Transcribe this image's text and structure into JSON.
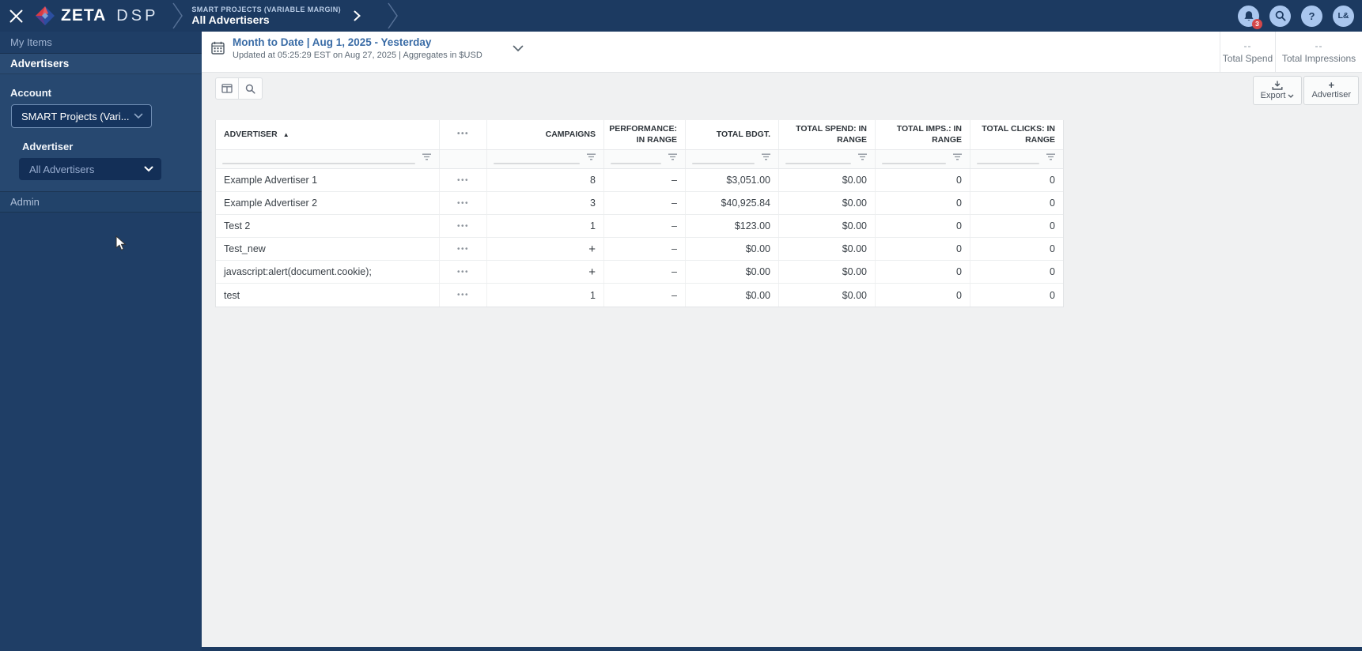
{
  "topbar": {
    "brand_primary": "ZETA",
    "brand_secondary": "DSP",
    "breadcrumb_account": "SMART PROJECTS (VARIABLE MARGIN)",
    "breadcrumb_page": "All Advertisers",
    "notification_count": "3",
    "avatar_initials": "L&"
  },
  "icons": {
    "more_options": "•••",
    "sort_asc": "▲",
    "help": "?",
    "plus": "+"
  },
  "sidebar": {
    "my_items": "My Items",
    "advertisers": "Advertisers",
    "admin": "Admin",
    "account_label": "Account",
    "account_value": "SMART Projects (Vari...",
    "advertiser_label": "Advertiser",
    "advertiser_value": "All Advertisers"
  },
  "date_header": {
    "range": "Month to Date | Aug 1, 2025 - Yesterday",
    "updated": "Updated at 05:25:29 EST on Aug 27, 2025 | Aggregates in $USD"
  },
  "stats": [
    {
      "value": "--",
      "label": "Total Spend"
    },
    {
      "value": "--",
      "label": "Total Impressions"
    }
  ],
  "toolbar": {
    "export": "Export",
    "add_advertiser": "Advertiser"
  },
  "table": {
    "columns": [
      "ADVERTISER",
      "CAMPAIGNS",
      "PERFORMANCE: IN RANGE",
      "TOTAL BDGT.",
      "TOTAL SPEND: IN RANGE",
      "TOTAL IMPS.: IN RANGE",
      "TOTAL CLICKS: IN RANGE"
    ],
    "rows": [
      {
        "advertiser": "Example Advertiser 1",
        "campaigns": "8",
        "performance": "–",
        "total_budget": "$3,051.00",
        "total_spend": "$0.00",
        "total_impressions": "0",
        "total_clicks": "0"
      },
      {
        "advertiser": "Example Advertiser 2",
        "campaigns": "3",
        "performance": "–",
        "total_budget": "$40,925.84",
        "total_spend": "$0.00",
        "total_impressions": "0",
        "total_clicks": "0"
      },
      {
        "advertiser": "Test 2",
        "campaigns": "1",
        "performance": "–",
        "total_budget": "$123.00",
        "total_spend": "$0.00",
        "total_impressions": "0",
        "total_clicks": "0"
      },
      {
        "advertiser": "Test_new",
        "campaigns": "+",
        "performance": "–",
        "total_budget": "$0.00",
        "total_spend": "$0.00",
        "total_impressions": "0",
        "total_clicks": "0"
      },
      {
        "advertiser": "javascript:alert(document.cookie);",
        "campaigns": "+",
        "performance": "–",
        "total_budget": "$0.00",
        "total_spend": "$0.00",
        "total_impressions": "0",
        "total_clicks": "0"
      },
      {
        "advertiser": "test",
        "campaigns": "1",
        "performance": "–",
        "total_budget": "$0.00",
        "total_spend": "$0.00",
        "total_impressions": "0",
        "total_clicks": "0"
      }
    ]
  },
  "colors": {
    "navy": "#1c3a61",
    "sidebar_navy": "#1f3e66",
    "highlight_navy": "#2a4b73",
    "accent_blue": "#3a6ca6",
    "icon_circle": "#a9c6ee",
    "badge_red": "#d4484a"
  }
}
